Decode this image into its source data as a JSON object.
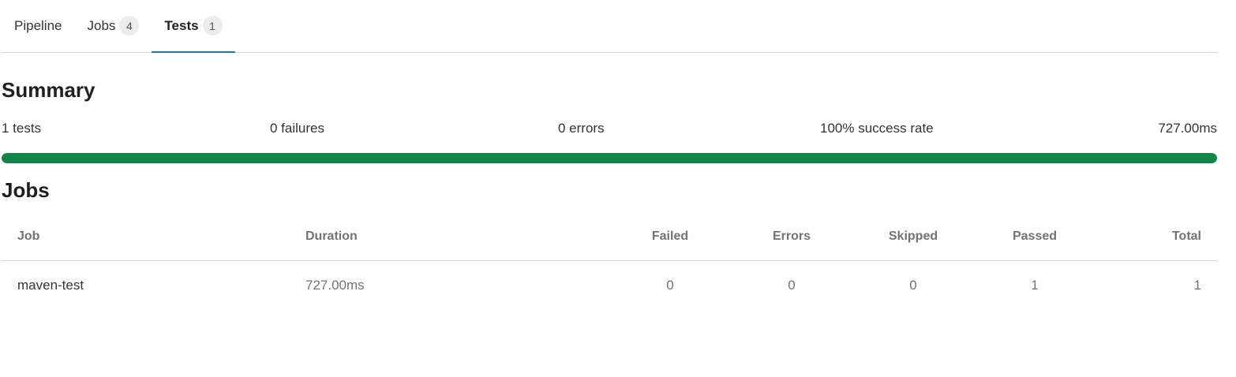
{
  "tabs": [
    {
      "label": "Pipeline",
      "count": null,
      "active": false
    },
    {
      "label": "Jobs",
      "count": "4",
      "active": false
    },
    {
      "label": "Tests",
      "count": "1",
      "active": true
    }
  ],
  "summary": {
    "title": "Summary",
    "tests": "1 tests",
    "failures": "0 failures",
    "errors": "0 errors",
    "success_rate": "100% success rate",
    "duration": "727.00ms",
    "progress_fraction": 1.0,
    "progress_color": "#108548"
  },
  "jobs": {
    "title": "Jobs",
    "columns": {
      "job": "Job",
      "duration": "Duration",
      "failed": "Failed",
      "errors": "Errors",
      "skipped": "Skipped",
      "passed": "Passed",
      "total": "Total"
    },
    "rows": [
      {
        "job": "maven-test",
        "duration": "727.00ms",
        "failed": "0",
        "errors": "0",
        "skipped": "0",
        "passed": "1",
        "total": "1"
      }
    ]
  },
  "colors": {
    "accent": "#1f75cb",
    "success": "#108548"
  }
}
